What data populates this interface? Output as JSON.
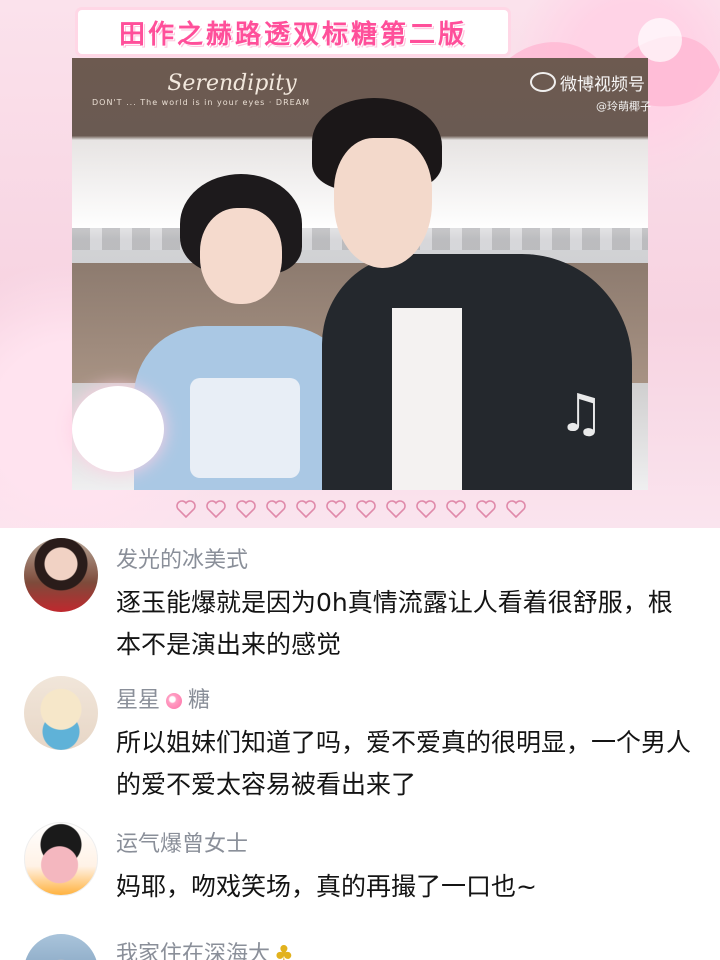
{
  "banner": {
    "title": "田作之赫路透双标糖第二版",
    "shop_sign": "Serendipity",
    "shop_line": "DON'T ... The world is in your eyes · DREAM",
    "watermark_brand": "微博视频号",
    "watermark_user": "@玲萌椰子"
  },
  "comments": [
    {
      "username": "发光的冰美式",
      "text": "逐玉能爆就是因为0h真情流露让人看着很舒服，根本不是演出来的感觉"
    },
    {
      "username_part1": "星星",
      "username_part2": "糖",
      "text": "所以姐妹们知道了吗，爱不爱真的很明显，一个男人的爱不爱太容易被看出来了"
    },
    {
      "username": "运气爆曾女士",
      "text": "妈耶，吻戏笑场，真的再撮了一口也~"
    },
    {
      "username": "我家住在深海大",
      "text": ""
    }
  ],
  "colors": {
    "title_pink": "#ff4f9a",
    "username_gray": "#8a8f99",
    "text_black": "#141414",
    "banner_bg": "#f7d3e1"
  }
}
